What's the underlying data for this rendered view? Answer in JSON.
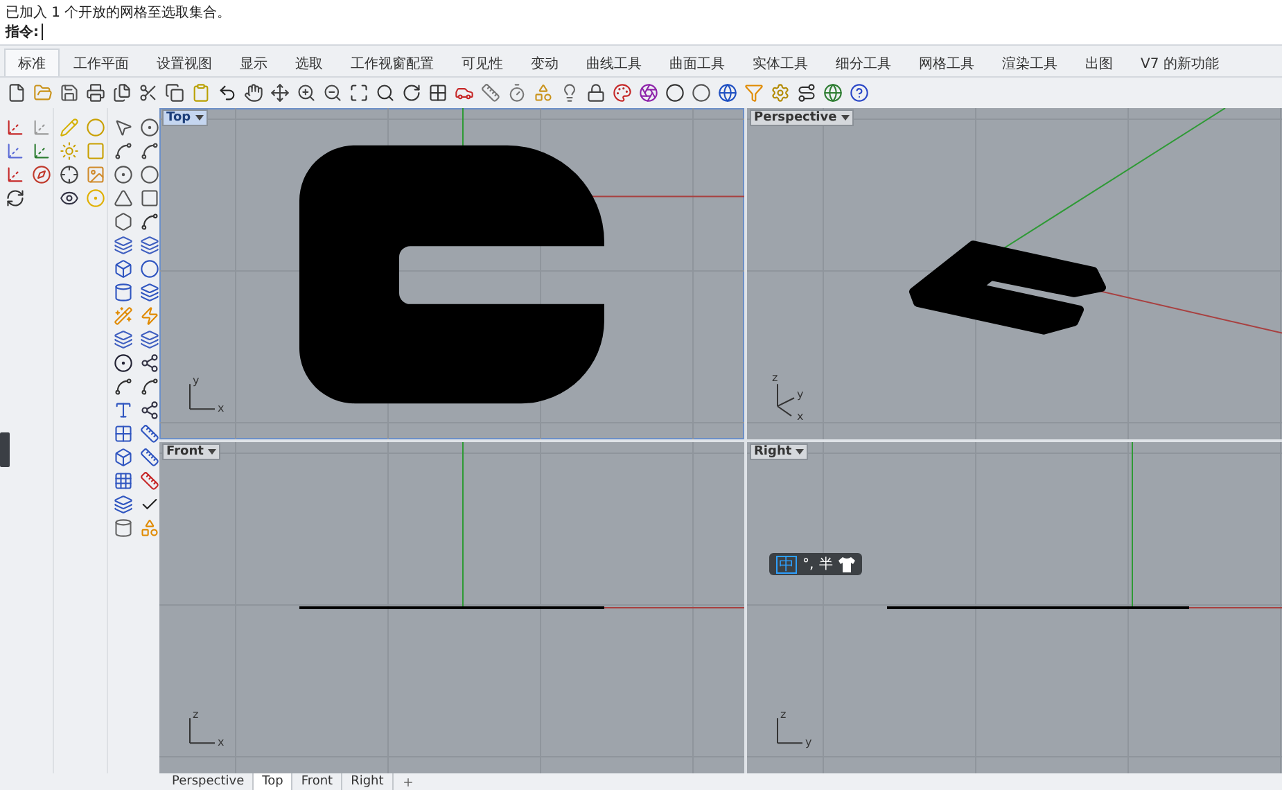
{
  "command_history": [
    "已加入 1 个开放的网格至选取集合。"
  ],
  "command_prompt": {
    "label": "指令:"
  },
  "ribbon_tabs": [
    {
      "label": "标准",
      "selected": true
    },
    {
      "label": "工作平面",
      "selected": false
    },
    {
      "label": "设置视图",
      "selected": false
    },
    {
      "label": "显示",
      "selected": false
    },
    {
      "label": "选取",
      "selected": false
    },
    {
      "label": "工作视窗配置",
      "selected": false
    },
    {
      "label": "可见性",
      "selected": false
    },
    {
      "label": "变动",
      "selected": false
    },
    {
      "label": "曲线工具",
      "selected": false
    },
    {
      "label": "曲面工具",
      "selected": false
    },
    {
      "label": "实体工具",
      "selected": false
    },
    {
      "label": "细分工具",
      "selected": false
    },
    {
      "label": "网格工具",
      "selected": false
    },
    {
      "label": "渲染工具",
      "selected": false
    },
    {
      "label": "出图",
      "selected": false
    },
    {
      "label": "V7 的新功能",
      "selected": false
    }
  ],
  "viewports": [
    {
      "title": "Top",
      "kind": "top",
      "selected": true,
      "axis_labels": [
        "y",
        "x"
      ]
    },
    {
      "title": "Perspective",
      "kind": "perspective",
      "selected": false,
      "axis_labels": [
        "z",
        "y",
        "x"
      ]
    },
    {
      "title": "Front",
      "kind": "front",
      "selected": false,
      "axis_labels": [
        "z",
        "x"
      ]
    },
    {
      "title": "Right",
      "kind": "right",
      "selected": false,
      "axis_labels": [
        "z",
        "y"
      ]
    }
  ],
  "ime_bar": {
    "mode": "中",
    "punctuation": "°,",
    "width": "半"
  },
  "viewport_tabs": [
    {
      "label": "Perspective",
      "selected": false
    },
    {
      "label": "Top",
      "selected": true
    },
    {
      "label": "Front",
      "selected": false
    },
    {
      "label": "Right",
      "selected": false
    }
  ]
}
